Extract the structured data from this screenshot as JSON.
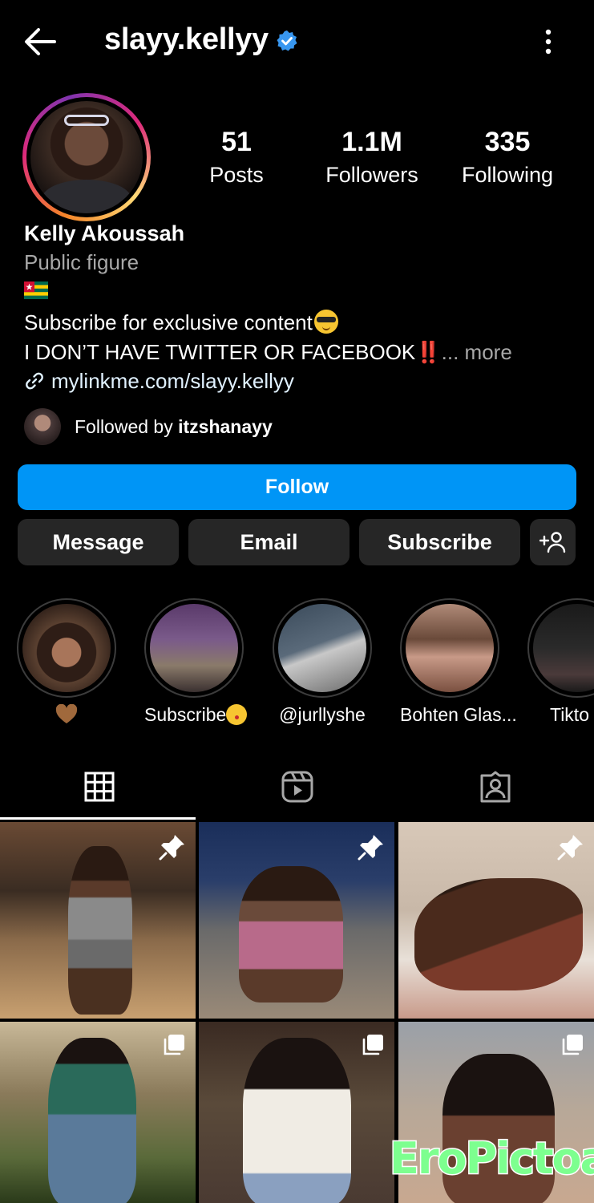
{
  "header": {
    "username": "slayy.kellyy",
    "verified_icon": "verified-badge-icon",
    "back_icon": "arrow-left-icon",
    "more_icon": "more-vertical-icon"
  },
  "profile": {
    "stats": [
      {
        "value": "51",
        "label": "Posts"
      },
      {
        "value": "1.1M",
        "label": "Followers"
      },
      {
        "value": "335",
        "label": "Following"
      }
    ],
    "full_name": "Kelly Akoussah",
    "category": "Public figure",
    "bio_line1": "Subscribe for exclusive content",
    "bio_line2": "I DON’T HAVE TWITTER OR FACEBOOK",
    "bio_bang": "‼️",
    "more_label": "... more",
    "link": "mylinkme.com/slayy.kellyy",
    "followed_by_prefix": "Followed by ",
    "followed_by_user": "itzshanayy"
  },
  "actions": {
    "follow": "Follow",
    "message": "Message",
    "email": "Email",
    "subscribe": "Subscribe"
  },
  "highlights": [
    {
      "label": ""
    },
    {
      "label": "Subscribe"
    },
    {
      "label": "@jurllyshe"
    },
    {
      "label": "Bohten Glas..."
    },
    {
      "label": "Tikto"
    }
  ],
  "tabs": [
    {
      "icon": "grid-icon",
      "active": true
    },
    {
      "icon": "reels-icon",
      "active": false
    },
    {
      "icon": "tagged-icon",
      "active": false
    }
  ],
  "watermark": "EroPictoa",
  "colors": {
    "accent": "#0095f6",
    "button_bg": "#262626",
    "muted_text": "#a8a8a8",
    "watermark": "#7dff8f"
  }
}
